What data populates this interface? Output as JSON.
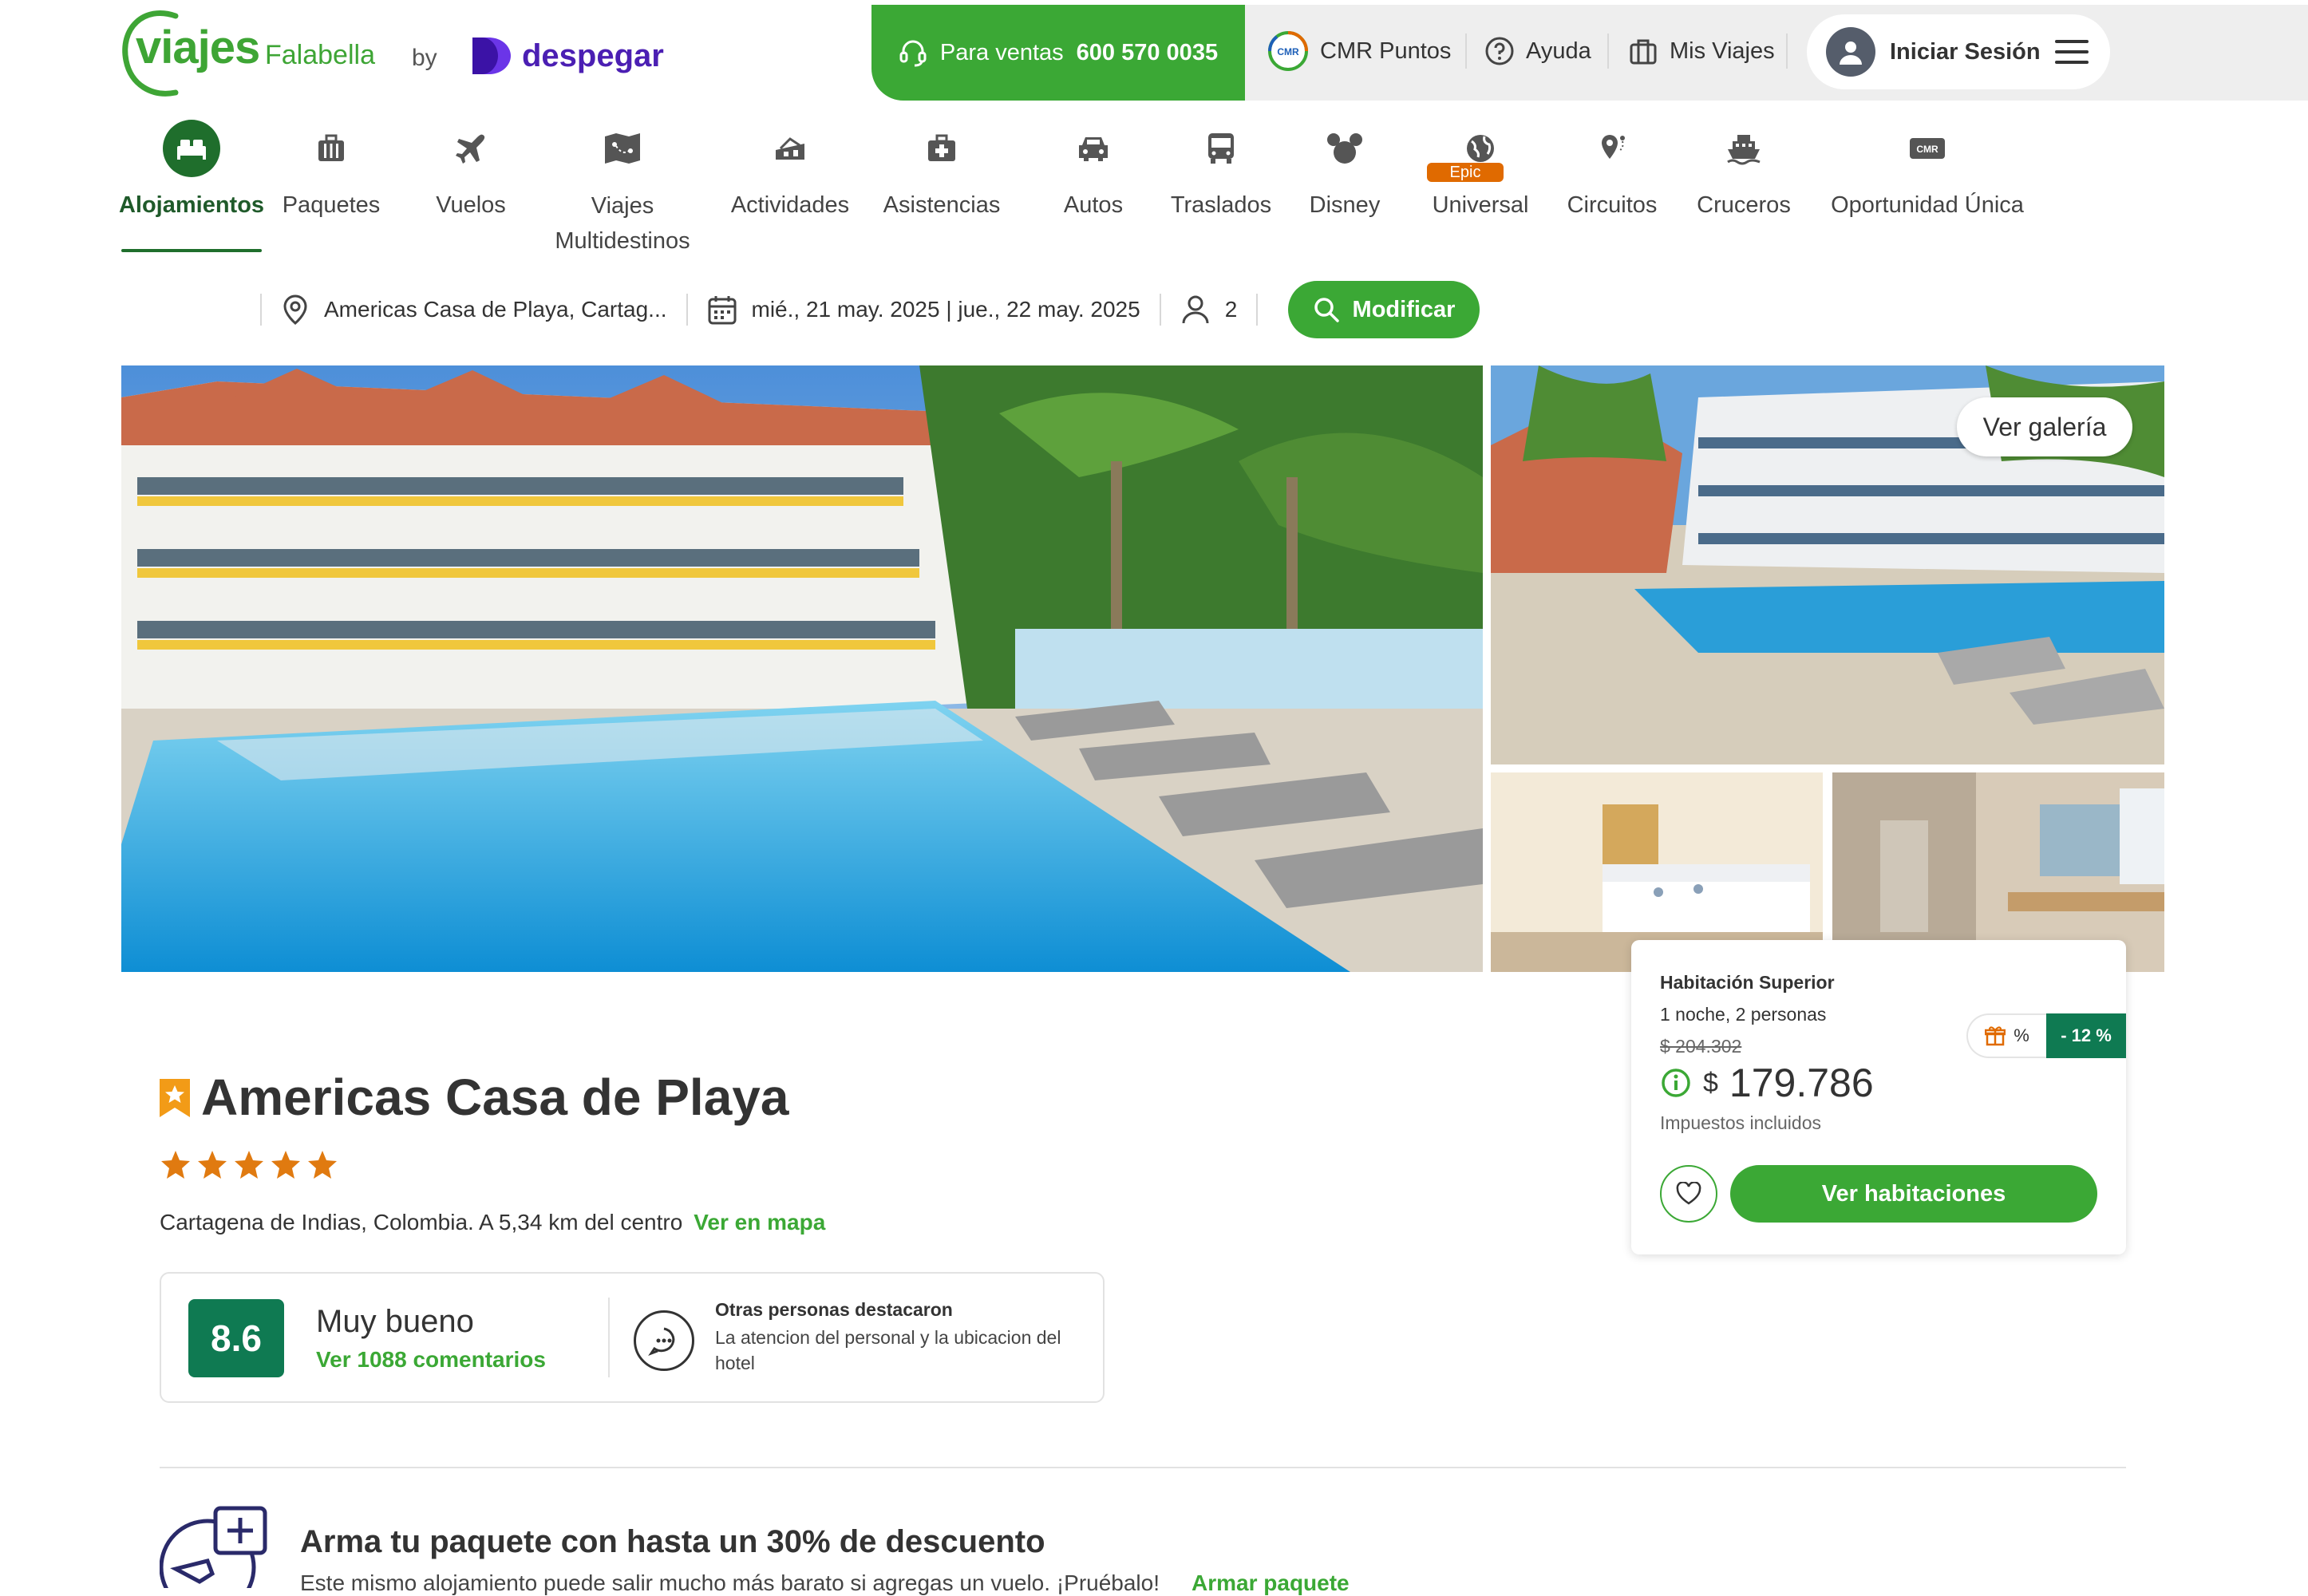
{
  "brand": {
    "logo_main": "viajes",
    "logo_sub": "Falabella",
    "by": "by",
    "partner": "despegar",
    "green": "#3ba835",
    "dark_green": "#1f6e2c",
    "teal": "#0f7a52"
  },
  "header": {
    "sales_label": "Para ventas",
    "sales_phone": "600 570 0035",
    "cmr": "CMR Puntos",
    "help": "Ayuda",
    "trips": "Mis Viajes",
    "login": "Iniciar Sesión"
  },
  "nav": {
    "items": [
      {
        "label": "Alojamientos",
        "icon": "bed-icon"
      },
      {
        "label": "Paquetes",
        "icon": "luggage-icon"
      },
      {
        "label": "Vuelos",
        "icon": "plane-icon"
      },
      {
        "label": "Viajes",
        "label2": "Multidestinos",
        "icon": "multidestination-icon"
      },
      {
        "label": "Actividades",
        "icon": "activities-icon"
      },
      {
        "label": "Asistencias",
        "icon": "medkit-icon"
      },
      {
        "label": "Autos",
        "icon": "car-icon"
      },
      {
        "label": "Traslados",
        "icon": "bus-icon"
      },
      {
        "label": "Disney",
        "icon": "mickey-icon"
      },
      {
        "label": "Universal",
        "icon": "globe-icon",
        "badge": "Epic"
      },
      {
        "label": "Circuitos",
        "icon": "pin-icon"
      },
      {
        "label": "Cruceros",
        "icon": "ship-icon"
      },
      {
        "label": "Oportunidad Única",
        "icon": "cmr-icon",
        "icon_text": "CMR"
      }
    ]
  },
  "search": {
    "destination": "Americas Casa de Playa, Cartag...",
    "dates": "mié., 21 may. 2025 | jue., 22 may. 2025",
    "guests": "2",
    "button": "Modificar"
  },
  "gallery": {
    "button": "Ver galería"
  },
  "price_card": {
    "room": "Habitación Superior",
    "nights": "1 noche, 2 personas",
    "old_price": "$ 204.302",
    "currency": "$",
    "price": "179.786",
    "tax": "Impuestos incluidos",
    "badge_percent": "%",
    "discount": "- 12 %",
    "cta": "Ver habitaciones"
  },
  "hotel": {
    "name": "Americas Casa de Playa",
    "stars": 5,
    "location": "Cartagena de Indias, Colombia. A 5,34 km del centro",
    "map_link": "Ver en mapa"
  },
  "rating": {
    "score": "8.6",
    "word": "Muy bueno",
    "comments_link": "Ver 1088 comentarios",
    "highlight_title": "Otras personas destacaron",
    "highlight_text": "La atencion del personal y la ubicacion del hotel"
  },
  "package": {
    "title": "Arma tu paquete con hasta un 30% de descuento",
    "text": "Este mismo alojamiento puede salir mucho más barato si agregas un vuelo. ¡Pruébalo!",
    "link": "Armar paquete"
  }
}
